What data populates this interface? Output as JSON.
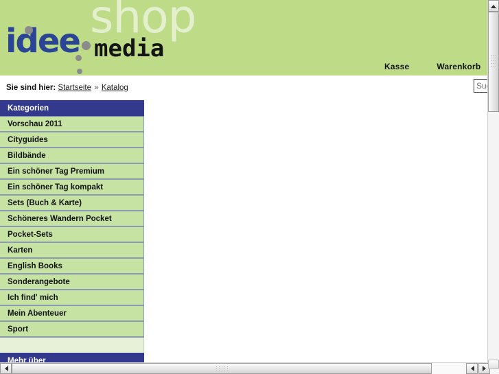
{
  "site": {
    "logo": {
      "shop_text": "shop",
      "brand_text": "idee",
      "media_text": "media"
    },
    "top_nav": [
      {
        "label": "Kasse"
      },
      {
        "label": "Warenkorb"
      }
    ],
    "search": {
      "placeholder": "Suche",
      "value": ""
    }
  },
  "breadcrumb": {
    "label": "Sie sind hier:",
    "items": [
      {
        "label": "Startseite"
      },
      {
        "label": "Katalog"
      }
    ],
    "separator": "»"
  },
  "sidebar": {
    "header": "Kategorien",
    "items": [
      {
        "label": "Vorschau 2011"
      },
      {
        "label": "Cityguides"
      },
      {
        "label": "Bildbände"
      },
      {
        "label": "Ein schöner Tag Premium"
      },
      {
        "label": "Ein schöner Tag kompakt"
      },
      {
        "label": "Sets (Buch & Karte)"
      },
      {
        "label": "Schöneres Wandern Pocket"
      },
      {
        "label": "Pocket-Sets"
      },
      {
        "label": "Karten"
      },
      {
        "label": "English Books"
      },
      {
        "label": "Sonderangebote"
      },
      {
        "label": "Ich find' mich"
      },
      {
        "label": "Mein Abenteuer"
      },
      {
        "label": "Sport"
      }
    ],
    "footer_header": "Mehr über"
  },
  "colors": {
    "header_green": "#bedc87",
    "sidebar_green": "#c7e3a4",
    "accent_blue": "#333a8e",
    "brand_blue": "#2a4496",
    "logo_shop_pale": "#e4f0cd",
    "dot_gray": "#8b8b8b"
  }
}
